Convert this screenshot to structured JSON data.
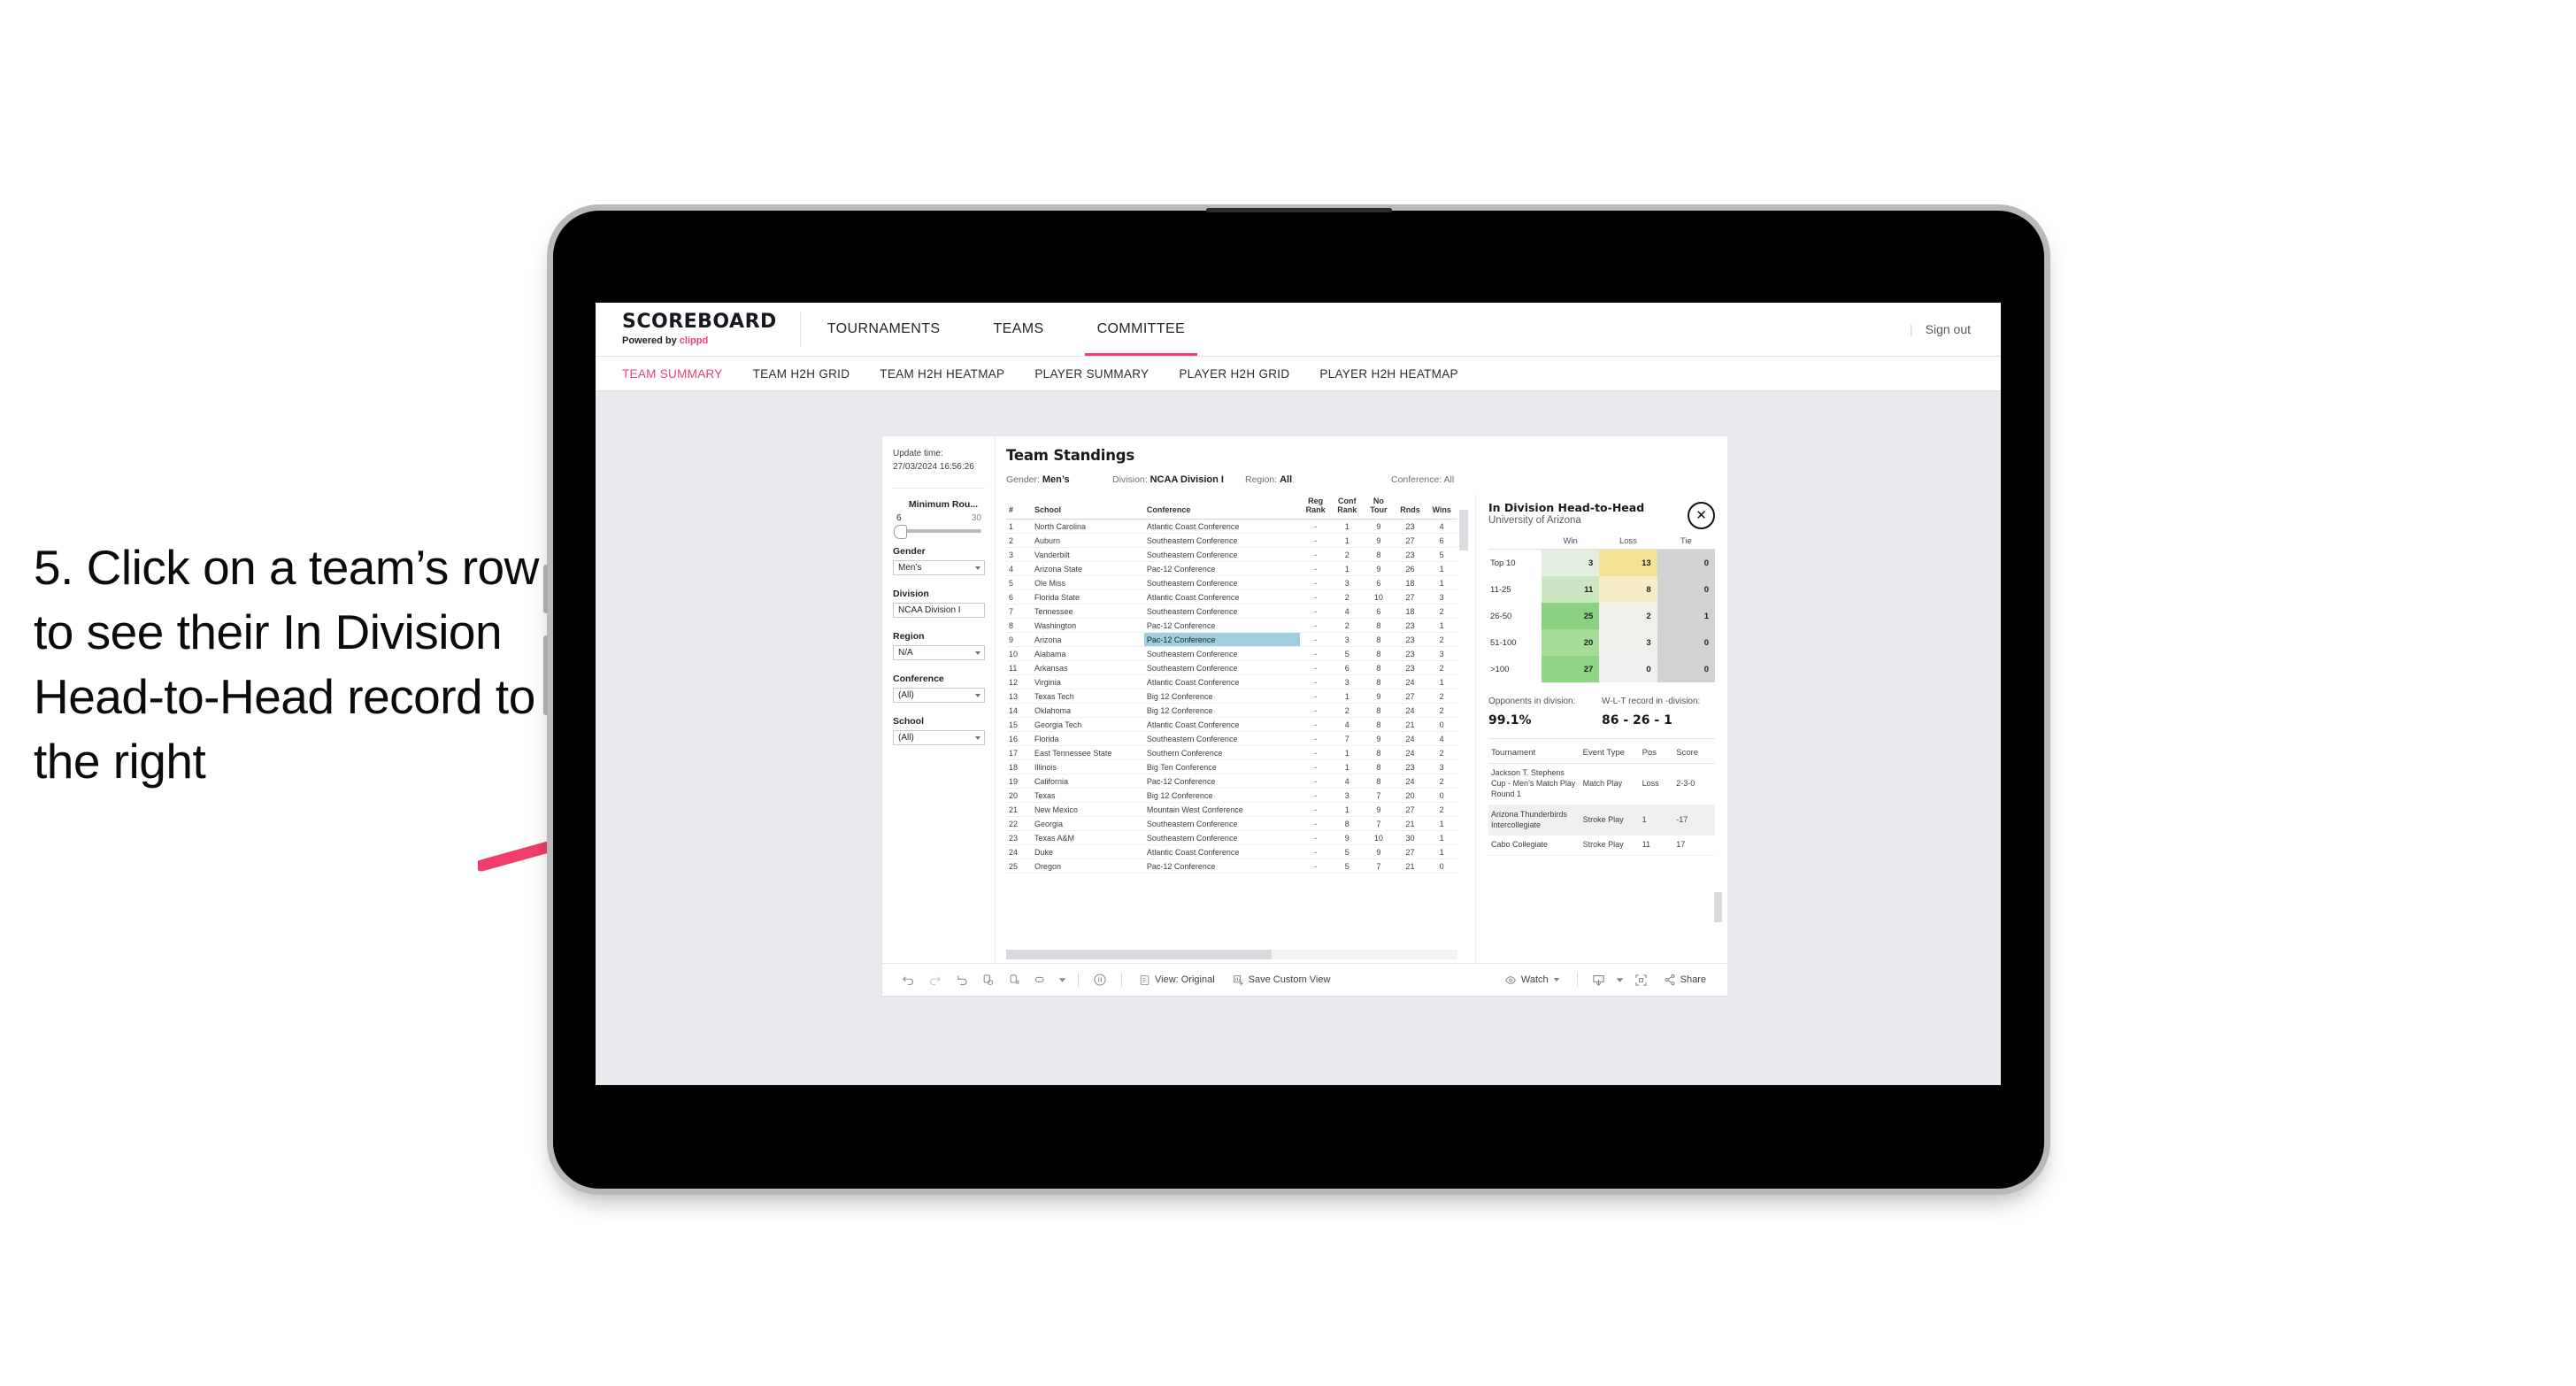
{
  "annotation": {
    "text": "5. Click on a team’s row to see their In Division Head-to-Head record to the right",
    "arrow_color": "#ee3e69"
  },
  "topnav": {
    "brand": "SCOREBOARD",
    "powered_prefix": "Powered by ",
    "powered_brand": "clippd",
    "items": [
      {
        "label": "TOURNAMENTS",
        "active": false
      },
      {
        "label": "TEAMS",
        "active": false
      },
      {
        "label": "COMMITTEE",
        "active": true
      }
    ],
    "divider": "|",
    "sign_out": "Sign out"
  },
  "subtabs": [
    {
      "label": "TEAM SUMMARY",
      "active": true
    },
    {
      "label": "TEAM H2H GRID",
      "active": false
    },
    {
      "label": "TEAM H2H HEATMAP",
      "active": false
    },
    {
      "label": "PLAYER SUMMARY",
      "active": false
    },
    {
      "label": "PLAYER H2H GRID",
      "active": false
    },
    {
      "label": "PLAYER H2H HEATMAP",
      "active": false
    }
  ],
  "rail": {
    "update_label": "Update time:",
    "update_value": "27/03/2024 16:56:26",
    "min_rounds_label": "Minimum Rou...",
    "min_rounds_low": "6",
    "min_rounds_high": "30",
    "filters": [
      {
        "label": "Gender",
        "value": "Men’s"
      },
      {
        "label": "Division",
        "value": "NCAA Division I"
      },
      {
        "label": "Region",
        "value": "N/A"
      },
      {
        "label": "Conference",
        "value": "(All)"
      },
      {
        "label": "School",
        "value": "(All)"
      }
    ]
  },
  "viz": {
    "title": "Team Standings",
    "filter_summary": [
      {
        "label": "Gender: ",
        "value": "Men’s"
      },
      {
        "label": "Division: ",
        "value": "NCAA Division I"
      },
      {
        "label": "Region: ",
        "value": "All"
      },
      {
        "label": "Conference: ",
        "value": "All"
      }
    ]
  },
  "standings": {
    "columns": [
      "#",
      "School",
      "Conference",
      "Reg Rank",
      "Conf Rank",
      "No Tour",
      "Rnds",
      "Wins"
    ],
    "columns_wrapped": [
      {
        "l1": "#",
        "l2": ""
      },
      {
        "l1": "School",
        "l2": ""
      },
      {
        "l1": "Conference",
        "l2": ""
      },
      {
        "l1": "Reg",
        "l2": "Rank"
      },
      {
        "l1": "Conf",
        "l2": "Rank"
      },
      {
        "l1": "No",
        "l2": "Tour"
      },
      {
        "l1": "",
        "l2": "Rnds"
      },
      {
        "l1": "",
        "l2": "Wins"
      }
    ],
    "selected_rank": 9,
    "rows": [
      {
        "rank": "1",
        "school": "North Carolina",
        "conference": "Atlantic Coast Conference",
        "reg": "-",
        "conf": "1",
        "notour": "9",
        "rnds": "23",
        "wins": "4"
      },
      {
        "rank": "2",
        "school": "Auburn",
        "conference": "Southeastern Conference",
        "reg": "-",
        "conf": "1",
        "notour": "9",
        "rnds": "27",
        "wins": "6"
      },
      {
        "rank": "3",
        "school": "Vanderbilt",
        "conference": "Southeastern Conference",
        "reg": "-",
        "conf": "2",
        "notour": "8",
        "rnds": "23",
        "wins": "5"
      },
      {
        "rank": "4",
        "school": "Arizona State",
        "conference": "Pac-12 Conference",
        "reg": "-",
        "conf": "1",
        "notour": "9",
        "rnds": "26",
        "wins": "1"
      },
      {
        "rank": "5",
        "school": "Ole Miss",
        "conference": "Southeastern Conference",
        "reg": "-",
        "conf": "3",
        "notour": "6",
        "rnds": "18",
        "wins": "1"
      },
      {
        "rank": "6",
        "school": "Florida State",
        "conference": "Atlantic Coast Conference",
        "reg": "-",
        "conf": "2",
        "notour": "10",
        "rnds": "27",
        "wins": "3"
      },
      {
        "rank": "7",
        "school": "Tennessee",
        "conference": "Southeastern Conference",
        "reg": "-",
        "conf": "4",
        "notour": "6",
        "rnds": "18",
        "wins": "2"
      },
      {
        "rank": "8",
        "school": "Washington",
        "conference": "Pac-12 Conference",
        "reg": "-",
        "conf": "2",
        "notour": "8",
        "rnds": "23",
        "wins": "1"
      },
      {
        "rank": "9",
        "school": "Arizona",
        "conference": "Pac-12 Conference",
        "reg": "-",
        "conf": "3",
        "notour": "8",
        "rnds": "23",
        "wins": "2"
      },
      {
        "rank": "10",
        "school": "Alabama",
        "conference": "Southeastern Conference",
        "reg": "-",
        "conf": "5",
        "notour": "8",
        "rnds": "23",
        "wins": "3"
      },
      {
        "rank": "11",
        "school": "Arkansas",
        "conference": "Southeastern Conference",
        "reg": "-",
        "conf": "6",
        "notour": "8",
        "rnds": "23",
        "wins": "2"
      },
      {
        "rank": "12",
        "school": "Virginia",
        "conference": "Atlantic Coast Conference",
        "reg": "-",
        "conf": "3",
        "notour": "8",
        "rnds": "24",
        "wins": "1"
      },
      {
        "rank": "13",
        "school": "Texas Tech",
        "conference": "Big 12 Conference",
        "reg": "-",
        "conf": "1",
        "notour": "9",
        "rnds": "27",
        "wins": "2"
      },
      {
        "rank": "14",
        "school": "Oklahoma",
        "conference": "Big 12 Conference",
        "reg": "-",
        "conf": "2",
        "notour": "8",
        "rnds": "24",
        "wins": "2"
      },
      {
        "rank": "15",
        "school": "Georgia Tech",
        "conference": "Atlantic Coast Conference",
        "reg": "-",
        "conf": "4",
        "notour": "8",
        "rnds": "21",
        "wins": "0"
      },
      {
        "rank": "16",
        "school": "Florida",
        "conference": "Southeastern Conference",
        "reg": "-",
        "conf": "7",
        "notour": "9",
        "rnds": "24",
        "wins": "4"
      },
      {
        "rank": "17",
        "school": "East Tennessee State",
        "conference": "Southern Conference",
        "reg": "-",
        "conf": "1",
        "notour": "8",
        "rnds": "24",
        "wins": "2"
      },
      {
        "rank": "18",
        "school": "Illinois",
        "conference": "Big Ten Conference",
        "reg": "-",
        "conf": "1",
        "notour": "8",
        "rnds": "23",
        "wins": "3"
      },
      {
        "rank": "19",
        "school": "California",
        "conference": "Pac-12 Conference",
        "reg": "-",
        "conf": "4",
        "notour": "8",
        "rnds": "24",
        "wins": "2"
      },
      {
        "rank": "20",
        "school": "Texas",
        "conference": "Big 12 Conference",
        "reg": "-",
        "conf": "3",
        "notour": "7",
        "rnds": "20",
        "wins": "0"
      },
      {
        "rank": "21",
        "school": "New Mexico",
        "conference": "Mountain West Conference",
        "reg": "-",
        "conf": "1",
        "notour": "9",
        "rnds": "27",
        "wins": "2"
      },
      {
        "rank": "22",
        "school": "Georgia",
        "conference": "Southeastern Conference",
        "reg": "-",
        "conf": "8",
        "notour": "7",
        "rnds": "21",
        "wins": "1"
      },
      {
        "rank": "23",
        "school": "Texas A&M",
        "conference": "Southeastern Conference",
        "reg": "-",
        "conf": "9",
        "notour": "10",
        "rnds": "30",
        "wins": "1"
      },
      {
        "rank": "24",
        "school": "Duke",
        "conference": "Atlantic Coast Conference",
        "reg": "-",
        "conf": "5",
        "notour": "9",
        "rnds": "27",
        "wins": "1"
      },
      {
        "rank": "25",
        "school": "Oregon",
        "conference": "Pac-12 Conference",
        "reg": "-",
        "conf": "5",
        "notour": "7",
        "rnds": "21",
        "wins": "0"
      }
    ]
  },
  "h2h": {
    "title": "In Division Head-to-Head",
    "subtitle": "University of Arizona",
    "close_icon": "✕",
    "columns": [
      "",
      "Win",
      "Loss",
      "Tie"
    ],
    "rows": [
      {
        "bucket": "Top 10",
        "win": "3",
        "loss": "13",
        "tie": "0",
        "win_color": "#e2efe1",
        "loss_color": "#f2e294",
        "tie_color": "#d2d2d2"
      },
      {
        "bucket": "11-25",
        "win": "11",
        "loss": "8",
        "tie": "0",
        "win_color": "#cce6c3",
        "loss_color": "#f7ecc9",
        "tie_color": "#d2d2d2"
      },
      {
        "bucket": "26-50",
        "win": "25",
        "loss": "2",
        "tie": "1",
        "win_color": "#8bd182",
        "loss_color": "#f0efe9",
        "tie_color": "#d2d2d2"
      },
      {
        "bucket": "51-100",
        "win": "20",
        "loss": "3",
        "tie": "0",
        "win_color": "#a5dc97",
        "loss_color": "#f1f0ea",
        "tie_color": "#d2d2d2"
      },
      {
        "bucket": ">100",
        "win": "27",
        "loss": "0",
        "tie": "0",
        "win_color": "#90d485",
        "loss_color": "#efefef",
        "tie_color": "#d2d2d2"
      }
    ],
    "stats": [
      {
        "label": "Opponents in division:",
        "value": "99.1%"
      },
      {
        "label": "W-L-T record in -division:",
        "value": "86 - 26 - 1"
      }
    ],
    "tournaments": {
      "columns": [
        "Tournament",
        "Event Type",
        "Pos",
        "Score"
      ],
      "rows": [
        {
          "name": "Jackson T. Stephens Cup - Men’s Match Play Round 1",
          "type": "Match Play",
          "pos": "Loss",
          "score": "2-3-0"
        },
        {
          "name": "Arizona Thunderbirds Intercollegiate",
          "type": "Stroke Play",
          "pos": "1",
          "score": "-17"
        },
        {
          "name": "Cabo Collegiate",
          "type": "Stroke Play",
          "pos": "11",
          "score": "17"
        }
      ]
    }
  },
  "toolbar": {
    "view_label": "View: Original",
    "save_label": "Save Custom View",
    "watch_label": "Watch",
    "share_label": "Share"
  }
}
